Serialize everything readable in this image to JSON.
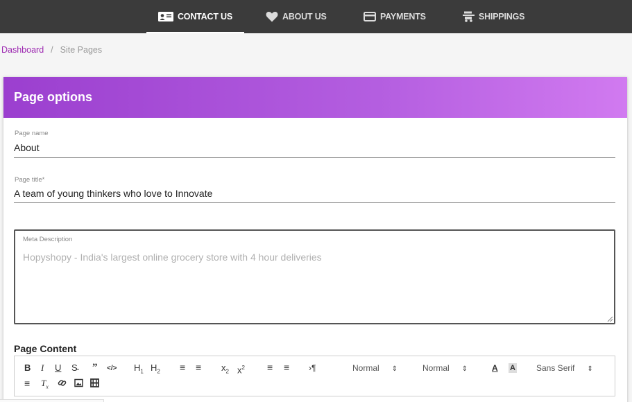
{
  "nav": {
    "tabs": [
      {
        "label": "CONTACT US",
        "icon": "contact-card-icon",
        "active": true
      },
      {
        "label": "ABOUT US",
        "icon": "heart-icon",
        "active": false
      },
      {
        "label": "PAYMENTS",
        "icon": "credit-card-icon",
        "active": false
      },
      {
        "label": "SHIPPINGS",
        "icon": "truck-icon",
        "active": false
      }
    ]
  },
  "breadcrumb": {
    "items": [
      "Dashboard",
      "Site Pages"
    ],
    "separator": "/"
  },
  "card": {
    "title": "Page options",
    "page_name": {
      "label": "Page name",
      "value": "About"
    },
    "page_title": {
      "label": "Page title*",
      "value": "A team of young thinkers who love to Innovate"
    },
    "meta_description": {
      "label": "Meta Description",
      "placeholder": "Hopyshopy - India's largest online grocery store with 4 hour deliveries"
    },
    "page_content_label": "Page Content",
    "toolbar": {
      "header_select": "Normal",
      "size_select": "Normal",
      "font_select": "Sans Serif",
      "h1": "H1",
      "h2": "H2"
    }
  },
  "colors": {
    "nav_bg": "#3b3b3b",
    "accent": "#9c27b0",
    "header_gradient_start": "#9b3fcf",
    "header_gradient_end": "#d17af0"
  }
}
